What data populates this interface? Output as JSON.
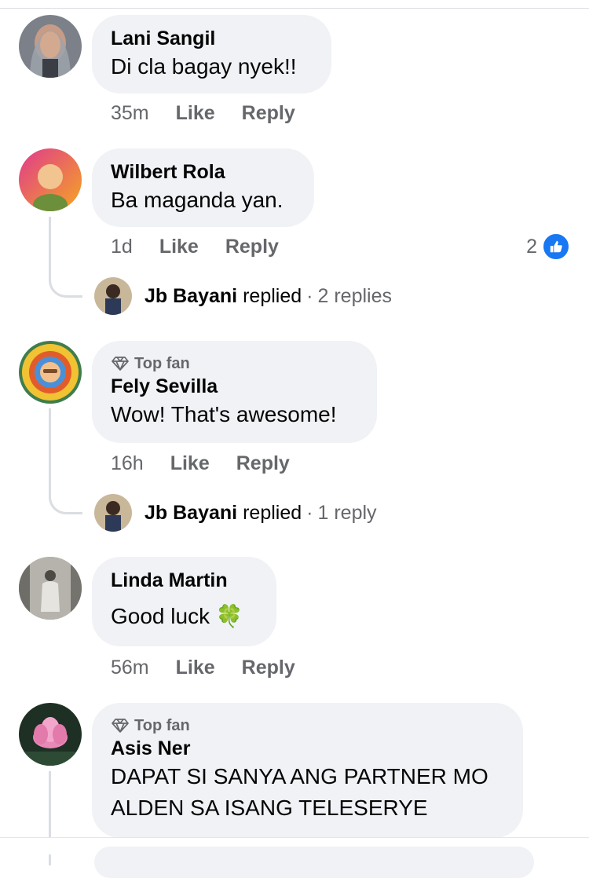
{
  "comments": [
    {
      "author": "Lani Sangil",
      "text": "Di cla bagay nyek!!",
      "time": "35m",
      "like_label": "Like",
      "reply_label": "Reply"
    },
    {
      "author": "Wilbert Rola",
      "text": "Ba maganda yan.",
      "time": "1d",
      "like_label": "Like",
      "reply_label": "Reply",
      "reaction_count": "2",
      "reply_summary": {
        "name": "Jb Bayani",
        "verb": "replied",
        "separator": "·",
        "count": "2 replies"
      }
    },
    {
      "badge": "Top fan",
      "author": "Fely Sevilla",
      "text": "Wow! That's awesome!",
      "time": "16h",
      "like_label": "Like",
      "reply_label": "Reply",
      "reply_summary": {
        "name": "Jb Bayani",
        "verb": "replied",
        "separator": "·",
        "count": "1 reply"
      }
    },
    {
      "author": "Linda Martin",
      "text": "Good luck",
      "emoji": "🍀",
      "time": "56m",
      "like_label": "Like",
      "reply_label": "Reply"
    },
    {
      "badge": "Top fan",
      "author": "Asis Ner",
      "text_lines": [
        "DAPAT SI SANYA ANG PARTNER MO",
        "ALDEN  SA ISANG TELESERYE"
      ]
    }
  ],
  "icons": {
    "badge": "diamond-icon",
    "reaction": "thumbs-up-icon"
  },
  "colors": {
    "bubble": "#f0f2f5",
    "secondary_text": "#65676b",
    "like_blue": "#1877f2"
  }
}
